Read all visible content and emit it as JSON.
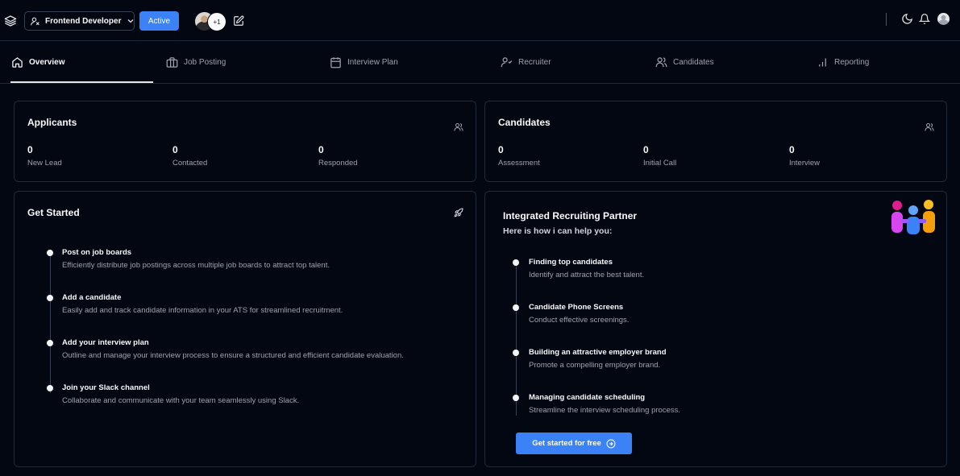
{
  "header": {
    "job_title": "Frontend Developer",
    "status": "Active",
    "more_members": "+1"
  },
  "tabs": [
    {
      "label": "Overview",
      "icon": "home-icon",
      "active": true
    },
    {
      "label": "Job Posting",
      "icon": "briefcase-icon"
    },
    {
      "label": "Interview Plan",
      "icon": "calendar-icon"
    },
    {
      "label": "Recruiter",
      "icon": "user-check-icon"
    },
    {
      "label": "Candidates",
      "icon": "users-icon"
    },
    {
      "label": "Reporting",
      "icon": "bar-chart-icon"
    }
  ],
  "applicants": {
    "title": "Applicants",
    "stats": [
      {
        "value": "0",
        "label": "New Lead"
      },
      {
        "value": "0",
        "label": "Contacted"
      },
      {
        "value": "0",
        "label": "Responded"
      }
    ]
  },
  "candidates": {
    "title": "Candidates",
    "stats": [
      {
        "value": "0",
        "label": "Assessment"
      },
      {
        "value": "0",
        "label": "Initial Call"
      },
      {
        "value": "0",
        "label": "Interview"
      }
    ]
  },
  "get_started": {
    "title": "Get Started",
    "steps": [
      {
        "title": "Post on job boards",
        "desc": "Efficiently distribute job postings across multiple job boards to attract top talent."
      },
      {
        "title": "Add a candidate",
        "desc": "Easily add and track candidate information in your ATS for streamlined recruitment."
      },
      {
        "title": "Add your interview plan",
        "desc": "Outline and manage your interview process to ensure a structured and efficient candidate evaluation."
      },
      {
        "title": "Join your Slack channel",
        "desc": "Collaborate and communicate with your team seamlessly using Slack."
      }
    ]
  },
  "partner": {
    "title": "Integrated Recruiting Partner",
    "subtitle": "Here is how i can help you:",
    "items": [
      {
        "title": "Finding top candidates",
        "desc": "Identify and attract the best talent."
      },
      {
        "title": "Candidate Phone Screens",
        "desc": "Conduct effective screenings."
      },
      {
        "title": "Building an attractive employer brand",
        "desc": "Promote a compelling employer brand."
      },
      {
        "title": "Managing candidate scheduling",
        "desc": "Streamline the interview scheduling process."
      }
    ],
    "cta": "Get started for free"
  },
  "colors": {
    "background": "#030712",
    "accent": "#3b82f6",
    "border": "#1f2937"
  }
}
